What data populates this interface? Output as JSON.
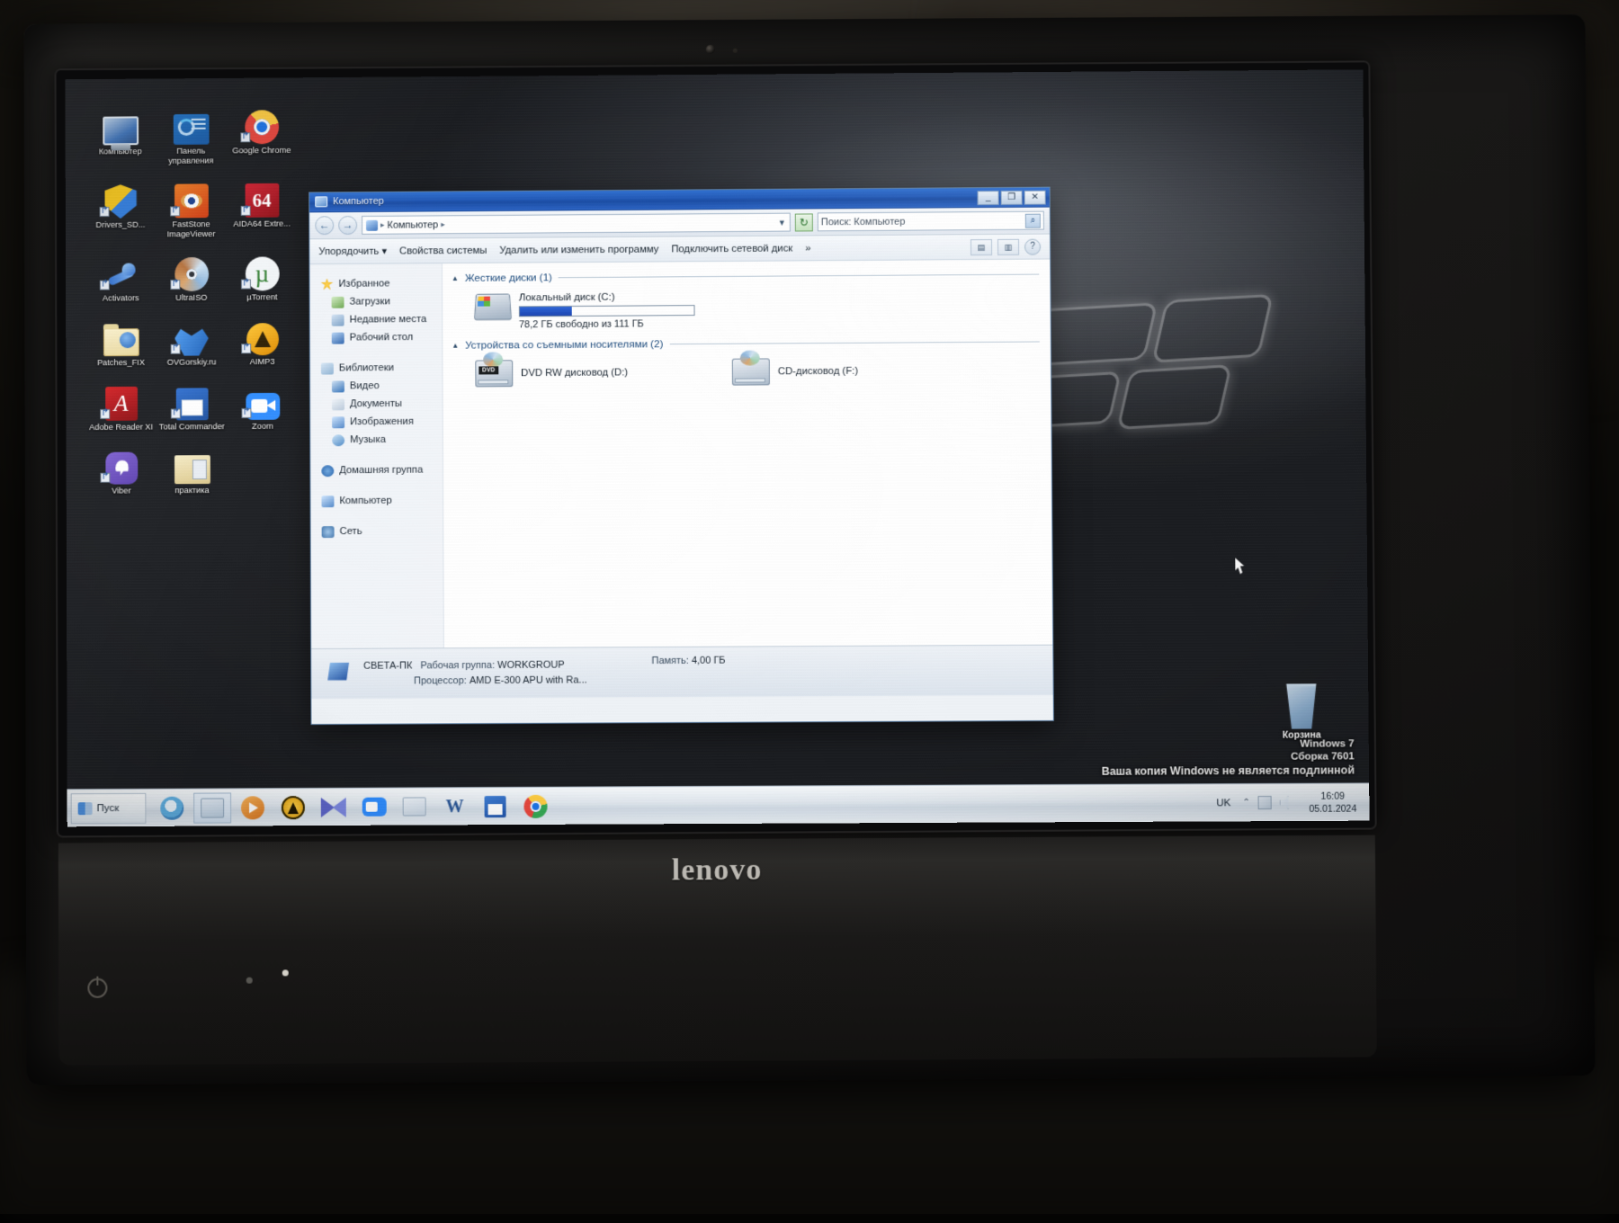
{
  "desktop": {
    "icons": [
      {
        "label": "Компьютер",
        "icon": "computer-icon"
      },
      {
        "label": "Панель управления",
        "icon": "control-panel-icon"
      },
      {
        "label": "Google Chrome",
        "icon": "chrome-icon"
      },
      {
        "label": "Drivers_SD...",
        "icon": "drivers-shield-icon"
      },
      {
        "label": "FastStone ImageViewer",
        "icon": "faststone-icon"
      },
      {
        "label": "AIDA64 Extre...",
        "icon": "aida64-icon"
      },
      {
        "label": "Activators",
        "icon": "activators-icon"
      },
      {
        "label": "UltraISO",
        "icon": "ultraiso-disc-icon"
      },
      {
        "label": "µTorrent",
        "icon": "utorrent-icon"
      },
      {
        "label": "Patches_FIX",
        "icon": "folder-patches-icon"
      },
      {
        "label": "OVGorskiy.ru",
        "icon": "ovgorskiy-icon"
      },
      {
        "label": "AIMP3",
        "icon": "aimp3-icon"
      },
      {
        "label": "Adobe Reader XI",
        "icon": "adobe-reader-icon"
      },
      {
        "label": "Total Commander",
        "icon": "total-commander-icon"
      },
      {
        "label": "Zoom",
        "icon": "zoom-icon"
      },
      {
        "label": "Viber",
        "icon": "viber-icon"
      },
      {
        "label": "практика",
        "icon": "folder-praktika-icon"
      }
    ],
    "recycle_bin": {
      "label": "Корзина",
      "icon": "recycle-bin-icon"
    },
    "watermark": {
      "line1": "Windows 7",
      "line2": "Сборка 7601",
      "line3": "Ваша копия Windows не является подлинной"
    }
  },
  "explorer": {
    "title": "Компьютер",
    "window_buttons": {
      "minimize": "_",
      "maximize": "❐",
      "close": "✕"
    },
    "address": {
      "back": "←",
      "forward": "→",
      "crumb_root": "Компьютер",
      "separator": "▸",
      "dropdown": "▼",
      "refresh": "↻"
    },
    "search": {
      "placeholder": "Поиск: Компьютер",
      "icon": "search-icon"
    },
    "commandbar": {
      "organize": "Упорядочить",
      "organize_caret": "▾",
      "system_properties": "Свойства системы",
      "uninstall": "Удалить или изменить программу",
      "map_drive": "Подключить сетевой диск",
      "overflow": "»",
      "view_button": "▤",
      "view_caret": "▾",
      "preview_button": "▥",
      "help_button": "?"
    },
    "navigation": {
      "groups": [
        {
          "header": {
            "label": "Избранное",
            "icon": "star-icon"
          },
          "items": [
            {
              "label": "Загрузки",
              "icon": "downloads-icon"
            },
            {
              "label": "Недавние места",
              "icon": "recent-places-icon"
            },
            {
              "label": "Рабочий стол",
              "icon": "desktop-icon"
            }
          ]
        },
        {
          "header": {
            "label": "Библиотеки",
            "icon": "libraries-icon"
          },
          "items": [
            {
              "label": "Видео",
              "icon": "video-icon"
            },
            {
              "label": "Документы",
              "icon": "documents-icon"
            },
            {
              "label": "Изображения",
              "icon": "pictures-icon"
            },
            {
              "label": "Музыка",
              "icon": "music-icon"
            }
          ]
        },
        {
          "header": {
            "label": "Домашняя группа",
            "icon": "homegroup-icon"
          },
          "items": []
        },
        {
          "header": {
            "label": "Компьютер",
            "icon": "computer-icon"
          },
          "items": []
        },
        {
          "header": {
            "label": "Сеть",
            "icon": "network-icon"
          },
          "items": []
        }
      ]
    },
    "content": {
      "group_hdd": {
        "title": "Жесткие диски (1)",
        "collapse": "▲",
        "drives": [
          {
            "name": "Локальный диск (C:)",
            "free_text": "78,2 ГБ свободно из 111 ГБ",
            "used_percent": 30,
            "icon": "hard-disk-icon"
          }
        ]
      },
      "group_removable": {
        "title": "Устройства со съемными носителями (2)",
        "collapse": "▲",
        "drives": [
          {
            "name": "DVD RW дисковод (D:)",
            "icon": "dvd-rw-icon",
            "badge": "DVD"
          },
          {
            "name": "CD-дисковод (F:)",
            "icon": "cd-drive-icon",
            "badge": ""
          }
        ]
      }
    },
    "details": {
      "computer_name": "СВЕТА-ПК",
      "workgroup_label": "Рабочая группа:",
      "workgroup_value": "WORKGROUP",
      "processor_label": "Процессор:",
      "processor_value": "AMD E-300 APU with Ra...",
      "memory_label": "Память:",
      "memory_value": "4,00 ГБ"
    }
  },
  "taskbar": {
    "start_label": "Пуск",
    "buttons": [
      {
        "name": "internet-explorer",
        "icon": "ie-icon"
      },
      {
        "name": "explorer",
        "icon": "explorer-icon"
      },
      {
        "name": "media-player",
        "icon": "wmp-icon"
      },
      {
        "name": "aimp",
        "icon": "aimp-icon"
      },
      {
        "name": "kmplayer",
        "icon": "kmplayer-icon"
      },
      {
        "name": "zoom",
        "icon": "zoom-icon"
      },
      {
        "name": "folder",
        "icon": "folder-icon"
      },
      {
        "name": "word",
        "icon": "word-icon"
      },
      {
        "name": "total-commander",
        "icon": "total-commander-icon"
      },
      {
        "name": "chrome",
        "icon": "chrome-icon"
      }
    ],
    "tray": {
      "language": "UK",
      "chevron": "⌃",
      "time": "16:09",
      "date": "05.01.2024"
    }
  },
  "hardware": {
    "brand": "lenovo"
  }
}
